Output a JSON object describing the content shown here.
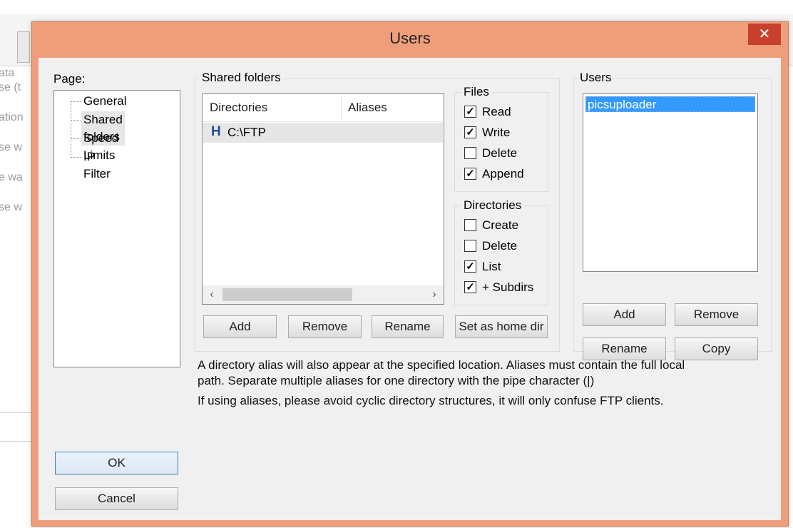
{
  "background": {
    "fragments": [
      "ata",
      "se (t",
      "ation",
      "se w",
      "e wa",
      "se w"
    ]
  },
  "dialog": {
    "title": "Users",
    "close_icon": "close-icon",
    "page_label": "Page:",
    "pages": [
      "General",
      "Shared folders",
      "Speed Limits",
      "IP Filter"
    ],
    "selected_page": "Shared folders"
  },
  "shared_folders": {
    "group_title": "Shared folders",
    "columns": [
      "Directories",
      "Aliases"
    ],
    "rows": [
      {
        "directory": "C:\\FTP",
        "alias": "",
        "home_marker": "H"
      }
    ],
    "buttons": {
      "add": "Add",
      "remove": "Remove",
      "rename": "Rename",
      "set_home": "Set as home dir"
    }
  },
  "files": {
    "group_title": "Files",
    "options": [
      {
        "label": "Read",
        "checked": true
      },
      {
        "label": "Write",
        "checked": true
      },
      {
        "label": "Delete",
        "checked": false
      },
      {
        "label": "Append",
        "checked": true
      }
    ]
  },
  "directories": {
    "group_title": "Directories",
    "options": [
      {
        "label": "Create",
        "checked": false
      },
      {
        "label": "Delete",
        "checked": false
      },
      {
        "label": "List",
        "checked": true
      },
      {
        "label": "+ Subdirs",
        "checked": true
      }
    ]
  },
  "users": {
    "group_title": "Users",
    "items": [
      "picsuploader"
    ],
    "selected": "picsuploader",
    "buttons": {
      "add": "Add",
      "remove": "Remove",
      "rename": "Rename",
      "copy": "Copy"
    }
  },
  "info": {
    "line1": "A directory alias will also appear at the specified location. Aliases must contain the full local",
    "line2": "path. Separate multiple aliases for one directory with the pipe character (|)",
    "line3": "If using aliases, please avoid cyclic directory structures, it will only confuse FTP clients."
  },
  "footer": {
    "ok": "OK",
    "cancel": "Cancel"
  },
  "colors": {
    "title_bar": "#ef9e7b",
    "close_button": "#c7402c",
    "selection": "#3399ff"
  }
}
